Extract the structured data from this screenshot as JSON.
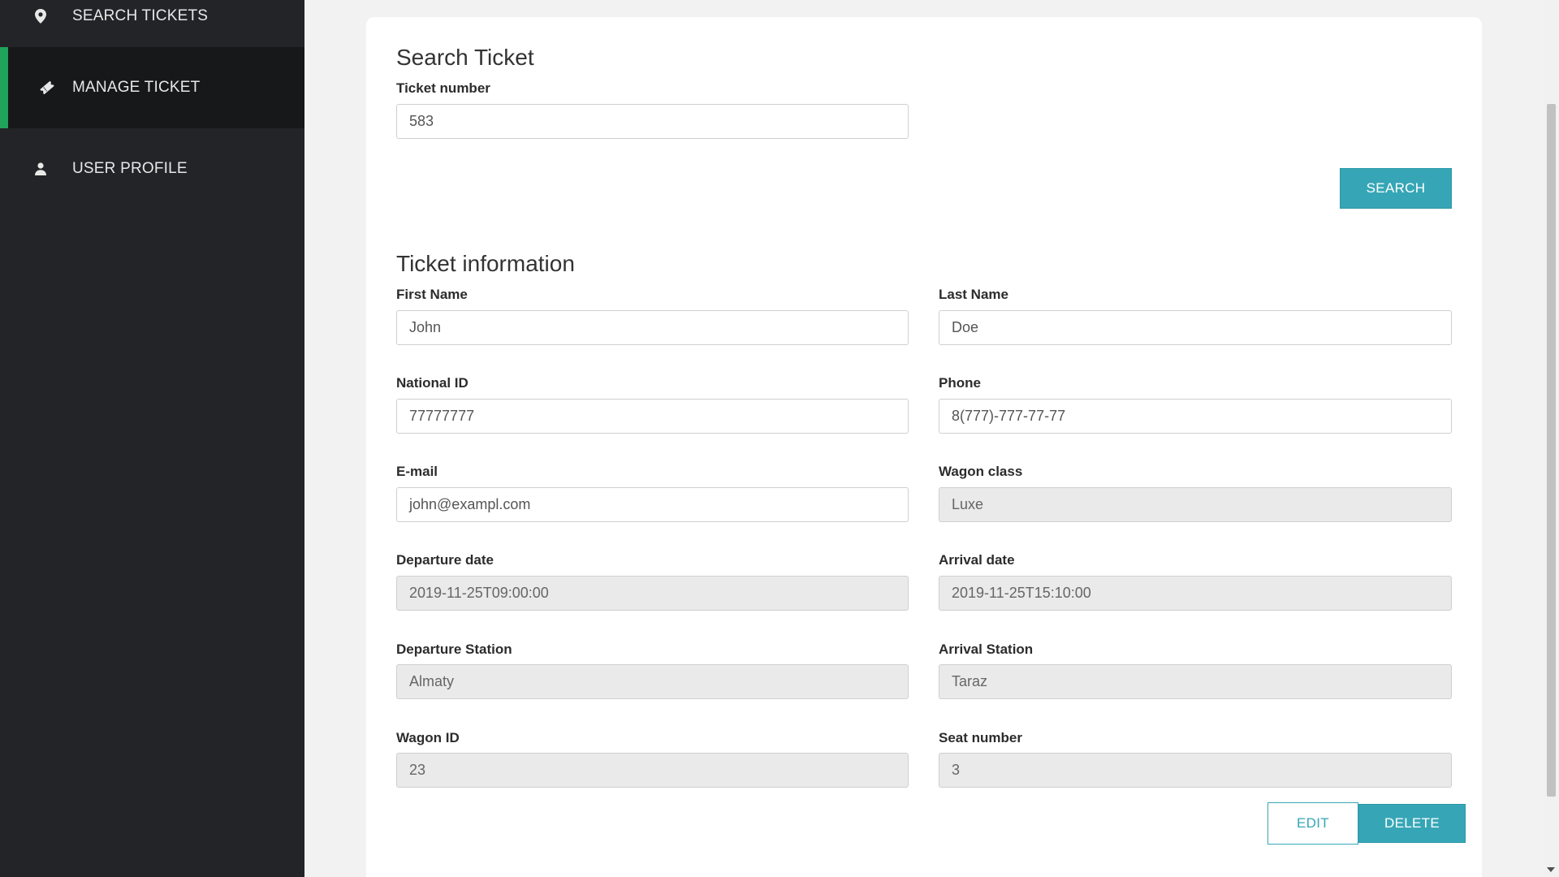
{
  "sidebar": {
    "items": [
      {
        "label": "SEARCH TICKETS",
        "icon": "map-pin-icon"
      },
      {
        "label": "MANAGE TICKET",
        "icon": "ticket-icon",
        "active": true
      },
      {
        "label": "USER PROFILE",
        "icon": "user-icon"
      }
    ],
    "accent_color": "#20a35a"
  },
  "search": {
    "title": "Search Ticket",
    "ticket_label": "Ticket number",
    "ticket_value": "583",
    "button": "SEARCH"
  },
  "info": {
    "title": "Ticket information",
    "first_name": {
      "label": "First Name",
      "value": "John"
    },
    "last_name": {
      "label": "Last Name",
      "value": "Doe"
    },
    "national_id": {
      "label": "National ID",
      "value": "77777777"
    },
    "phone": {
      "label": "Phone",
      "value": "8(777)-777-77-77"
    },
    "email": {
      "label": "E-mail",
      "value": "john@exampl.com"
    },
    "wagon_class": {
      "label": "Wagon class",
      "value": "Luxe"
    },
    "departure_date": {
      "label": "Departure date",
      "value": "2019-11-25T09:00:00"
    },
    "arrival_date": {
      "label": "Arrival date",
      "value": "2019-11-25T15:10:00"
    },
    "departure_station": {
      "label": "Departure Station",
      "value": "Almaty"
    },
    "arrival_station": {
      "label": "Arrival Station",
      "value": "Taraz"
    },
    "wagon_id": {
      "label": "Wagon ID",
      "value": "23"
    },
    "seat_number": {
      "label": "Seat number",
      "value": "3"
    }
  },
  "actions": {
    "edit": "EDIT",
    "delete": "DELETE"
  },
  "colors": {
    "accent": "#36a6b6",
    "sidebar_bg": "#232427"
  }
}
